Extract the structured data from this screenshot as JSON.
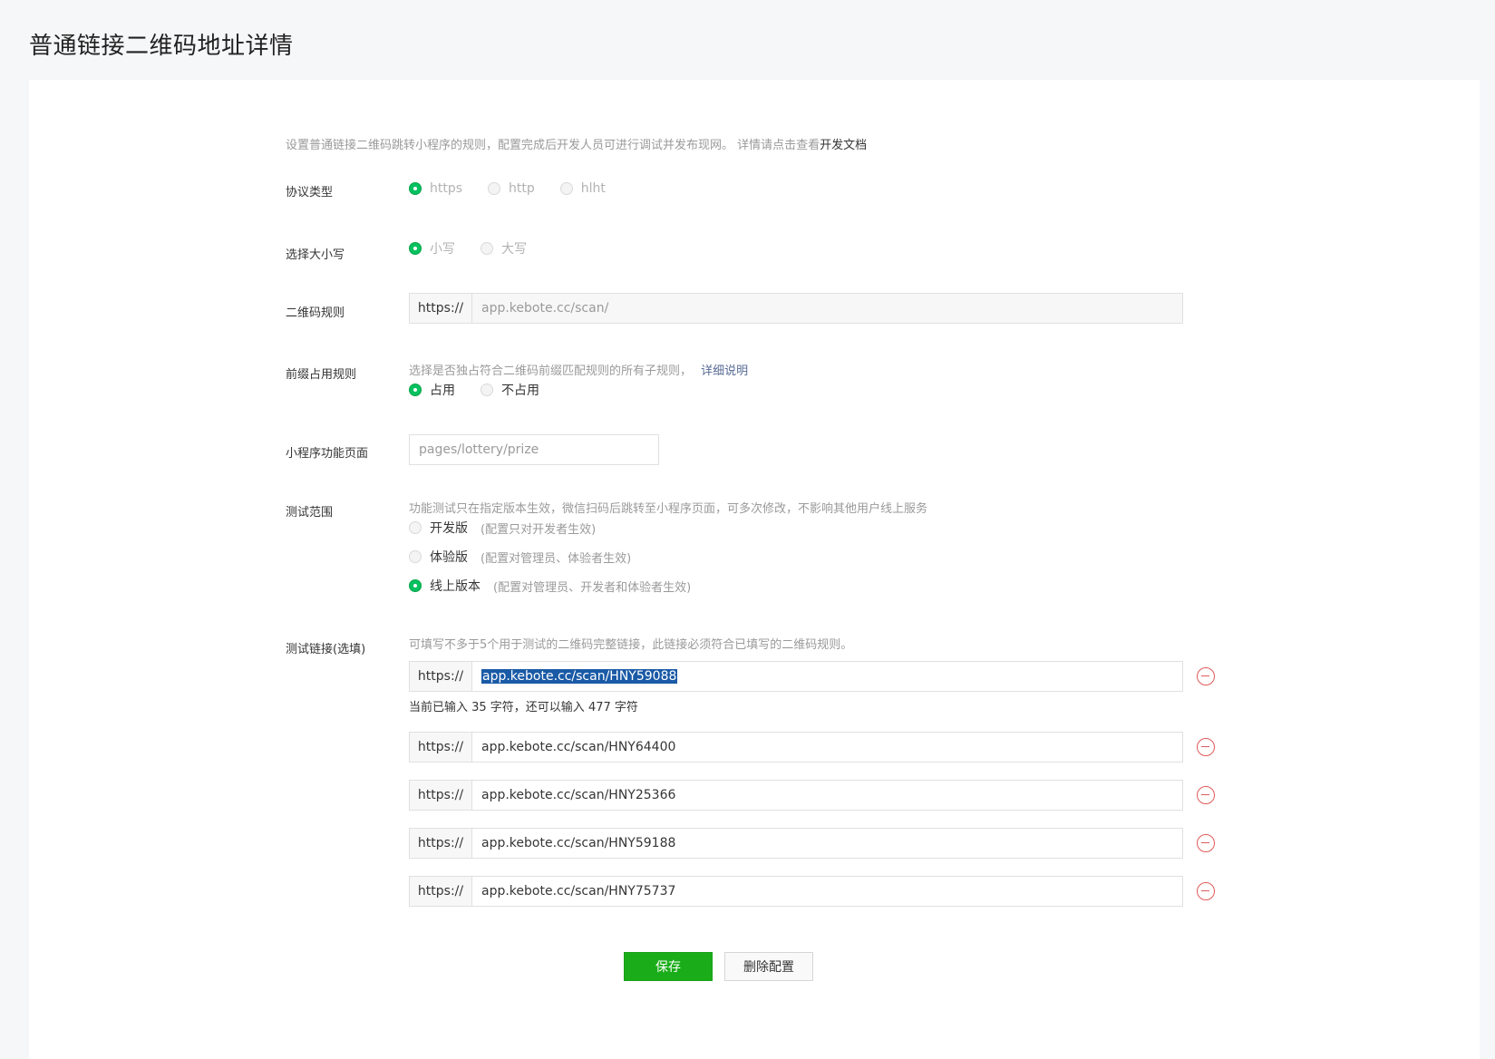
{
  "page": {
    "title": "普通链接二维码地址详情"
  },
  "intro": {
    "text": "设置普通链接二维码跳转小程序的规则，配置完成后开发人员可进行调试并发布现网。 详情请点击查看",
    "link": "开发文档"
  },
  "protocol": {
    "label": "协议类型",
    "options": [
      "https",
      "http",
      "hlht"
    ],
    "selected": "https"
  },
  "case": {
    "label": "选择大小写",
    "options": [
      "小写",
      "大写"
    ],
    "selected": "小写"
  },
  "qr_rule": {
    "label": "二维码规则",
    "prefix": "https://",
    "value": "app.kebote.cc/scan/"
  },
  "prefix_rule": {
    "label": "前缀占用规则",
    "desc": "选择是否独占符合二维码前缀匹配规则的所有子规则，",
    "link": "详细说明",
    "options": [
      "占用",
      "不占用"
    ],
    "selected": "占用"
  },
  "page_path": {
    "label": "小程序功能页面",
    "value": "pages/lottery/prize"
  },
  "test_scope": {
    "label": "测试范围",
    "desc": "功能测试只在指定版本生效，微信扫码后跳转至小程序页面，可多次修改，不影响其他用户线上服务",
    "options": [
      {
        "name": "开发版",
        "note": "(配置只对开发者生效)"
      },
      {
        "name": "体验版",
        "note": "(配置对管理员、体验者生效)"
      },
      {
        "name": "线上版本",
        "note": "(配置对管理员、开发者和体验者生效)"
      }
    ],
    "selected": "线上版本"
  },
  "test_links": {
    "label": "测试链接(选填)",
    "desc": "可填写不多于5个用于测试的二维码完整链接，此链接必须符合已填写的二维码规则。",
    "prefix": "https://",
    "count_hint": "当前已输入 35 字符，还可以输入 477 字符",
    "links": [
      "app.kebote.cc/scan/HNY59088",
      "app.kebote.cc/scan/HNY64400",
      "app.kebote.cc/scan/HNY25366",
      "app.kebote.cc/scan/HNY59188",
      "app.kebote.cc/scan/HNY75737"
    ],
    "remove_icon": "minus-circle-icon"
  },
  "actions": {
    "save": "保存",
    "delete": "删除配置"
  },
  "colors": {
    "primary": "#1aad19",
    "radio_on": "#07c160",
    "danger": "#e05a5a",
    "link": "#576b95"
  }
}
